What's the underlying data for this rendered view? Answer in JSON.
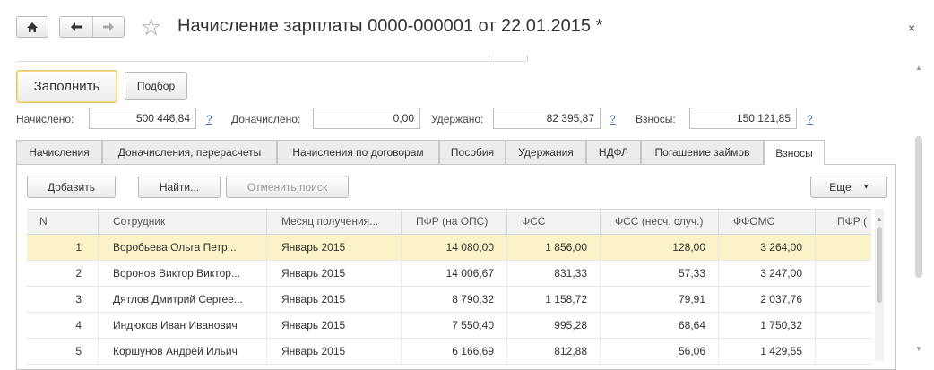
{
  "window": {
    "title": "Начисление зарплаты 0000-000001 от 22.01.2015 *",
    "close_glyph": "×",
    "star_glyph": "☆"
  },
  "toolbar": {
    "fill_label": "Заполнить",
    "pick_label": "Подбор"
  },
  "totals": {
    "accrued_label": "Начислено:",
    "accrued_value": "500 446,84",
    "additional_label": "Доначислено:",
    "additional_value": "0,00",
    "withheld_label": "Удержано:",
    "withheld_value": "82 395,87",
    "contrib_label": "Взносы:",
    "contrib_value": "150 121,85",
    "help_glyph": "?"
  },
  "tabs": [
    {
      "label": "Начисления"
    },
    {
      "label": "Доначисления, перерасчеты"
    },
    {
      "label": "Начисления по договорам"
    },
    {
      "label": "Пособия"
    },
    {
      "label": "Удержания"
    },
    {
      "label": "НДФЛ"
    },
    {
      "label": "Погашение займов"
    },
    {
      "label": "Взносы",
      "active": true
    }
  ],
  "table_toolbar": {
    "add_label": "Добавить",
    "find_label": "Найти...",
    "cancel_search_label": "Отменить поиск",
    "more_label": "Еще",
    "more_glyph": "▾"
  },
  "table": {
    "columns": [
      "N",
      "Сотрудник",
      "Месяц получения...",
      "ПФР (на ОПС)",
      "ФСС",
      "ФСС (несч. случ.)",
      "ФФОМС",
      "ПФР ("
    ],
    "rows": [
      {
        "n": "1",
        "employee": "Воробьева Ольга Петр...",
        "month": "Январь 2015",
        "pfr": "14 080,00",
        "fss": "1 856,00",
        "fss_ns": "128,00",
        "ffoms": "3 264,00",
        "selected": true
      },
      {
        "n": "2",
        "employee": "Воронов Виктор Виктор...",
        "month": "Январь 2015",
        "pfr": "14 006,67",
        "fss": "831,33",
        "fss_ns": "57,33",
        "ffoms": "3 247,00"
      },
      {
        "n": "3",
        "employee": "Дятлов Дмитрий Сергее...",
        "month": "Январь 2015",
        "pfr": "8 790,32",
        "fss": "1 158,72",
        "fss_ns": "79,91",
        "ffoms": "2 037,76"
      },
      {
        "n": "4",
        "employee": "Индюков Иван Иванович",
        "month": "Январь 2015",
        "pfr": "7 550,40",
        "fss": "995,28",
        "fss_ns": "68,64",
        "ffoms": "1 750,32"
      },
      {
        "n": "5",
        "employee": "Коршунов Андрей Ильич",
        "month": "Январь 2015",
        "pfr": "6 166,69",
        "fss": "812,88",
        "fss_ns": "56,06",
        "ffoms": "1 429,55"
      }
    ]
  }
}
